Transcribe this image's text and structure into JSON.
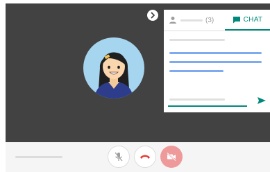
{
  "chat_panel": {
    "tabs": {
      "people_count": "(3)",
      "chat_label": "CHAT"
    }
  },
  "controls": {
    "mic": {
      "state": "muted",
      "icon": "mic-off-icon"
    },
    "hangup": {
      "icon": "phone-hangup-icon",
      "color": "#e53935"
    },
    "camera": {
      "state": "off",
      "icon": "videocam-off-icon",
      "color": "#ef9a9a"
    }
  },
  "colors": {
    "video_background": "#424242",
    "accent": "#00897b",
    "message_line": "#7eaaf0",
    "avatar_background": "#a6d6ef"
  }
}
